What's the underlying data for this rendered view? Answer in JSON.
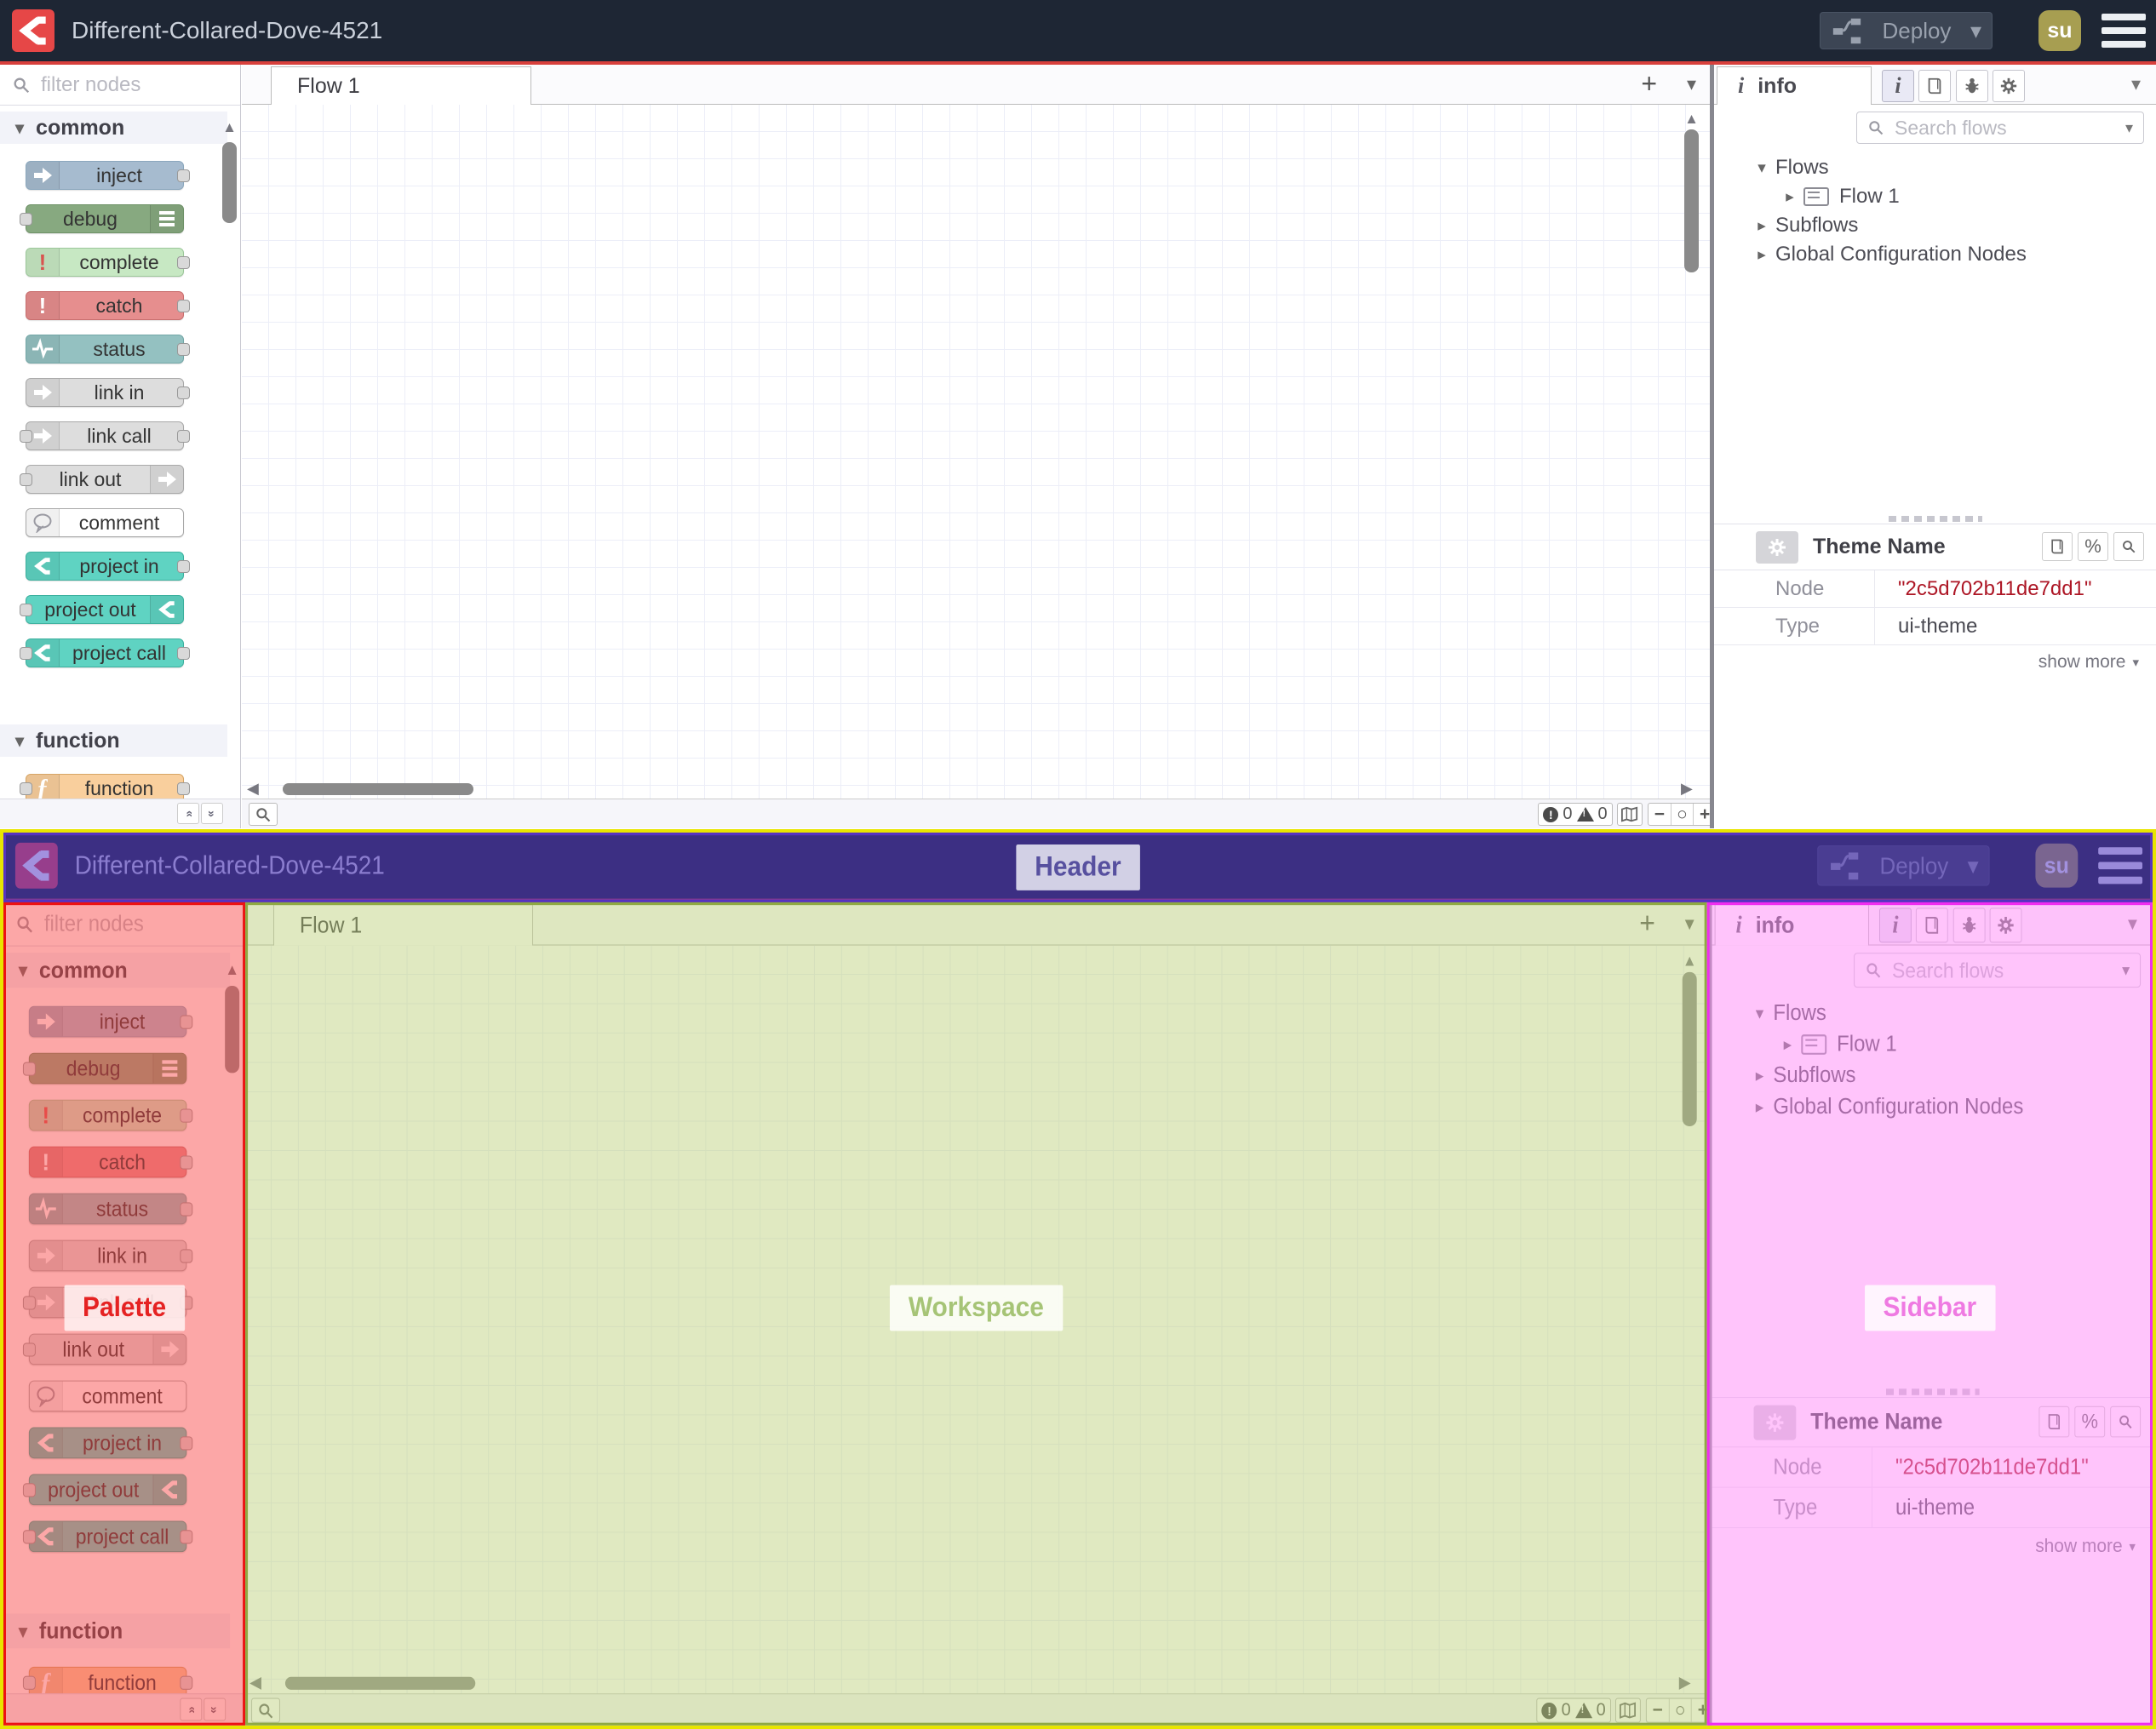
{
  "header": {
    "title": "Different-Collared-Dove-4521",
    "deploy_label": "Deploy",
    "user_initials": "su"
  },
  "palette": {
    "filter_placeholder": "filter nodes",
    "categories": [
      {
        "label": "common",
        "nodes": [
          {
            "label": "inject",
            "color": "#a6bbcf",
            "border": "#8ba7bd",
            "icon": "arrow",
            "icon_side": "l",
            "ports": "r"
          },
          {
            "label": "debug",
            "color": "#87a980",
            "border": "#6f9268",
            "icon": "bars",
            "icon_side": "r",
            "ports": "l"
          },
          {
            "label": "complete",
            "color": "#c7e8c3",
            "border": "#9cc79a",
            "icon": "excl-red",
            "icon_side": "l",
            "ports": "r"
          },
          {
            "label": "catch",
            "color": "#e68e8e",
            "border": "#c96f6f",
            "icon": "excl",
            "icon_side": "l",
            "ports": "r"
          },
          {
            "label": "status",
            "color": "#94c1c1",
            "border": "#73a7a7",
            "icon": "pulse",
            "icon_side": "l",
            "ports": "r"
          },
          {
            "label": "link in",
            "color": "#dddddd",
            "border": "#a9a9a9",
            "icon": "arrow",
            "icon_side": "l",
            "ports": "r"
          },
          {
            "label": "link call",
            "color": "#dddddd",
            "border": "#a9a9a9",
            "icon": "arrow",
            "icon_side": "l",
            "ports": "lr"
          },
          {
            "label": "link out",
            "color": "#dddddd",
            "border": "#a9a9a9",
            "icon": "arrow",
            "icon_side": "r",
            "ports": "l"
          },
          {
            "label": "comment",
            "color": "#ffffff",
            "border": "#a9a9a9",
            "icon": "bubble",
            "icon_side": "l",
            "ports": ""
          },
          {
            "label": "project in",
            "color": "#5fd3c2",
            "border": "#3cb09e",
            "icon": "nrmark",
            "icon_side": "l",
            "ports": "r"
          },
          {
            "label": "project out",
            "color": "#5fd3c2",
            "border": "#3cb09e",
            "icon": "nrmark",
            "icon_side": "r",
            "ports": "l"
          },
          {
            "label": "project call",
            "color": "#5fd3c2",
            "border": "#3cb09e",
            "icon": "nrmark",
            "icon_side": "l",
            "ports": "lr"
          }
        ]
      },
      {
        "label": "function",
        "nodes": [
          {
            "label": "function",
            "color": "#f9cf9d",
            "border": "#d6a566",
            "icon": "fn",
            "icon_side": "l",
            "ports": "lr"
          }
        ]
      }
    ]
  },
  "workspace": {
    "tab_label": "Flow 1",
    "add_tab_label": "+",
    "status": {
      "error_count": "0",
      "warning_count": "0"
    }
  },
  "sidebar": {
    "tab_label": "info",
    "search_placeholder": "Search flows",
    "tree": [
      {
        "label": "Flows",
        "chevron": "down",
        "depth": 0,
        "flow_icon": false
      },
      {
        "label": "Flow 1",
        "chevron": "right",
        "depth": 1,
        "flow_icon": true
      },
      {
        "label": "Subflows",
        "chevron": "right",
        "depth": 0,
        "flow_icon": false
      },
      {
        "label": "Global Configuration Nodes",
        "chevron": "right",
        "depth": 0,
        "flow_icon": false
      }
    ],
    "panel": {
      "title": "Theme Name",
      "rows": [
        {
          "key": "Node",
          "value": "\"2c5d702b11de7dd1\""
        },
        {
          "key": "Type",
          "value": "ui-theme"
        }
      ],
      "show_more_label": "show more"
    }
  },
  "annotations": {
    "header": "Header",
    "palette": "Palette",
    "workspace": "Workspace",
    "sidebar": "Sidebar"
  },
  "colors": {
    "header_bg": "#1e2634",
    "header_accent_line": "#d8403c",
    "logo_red": "#e64747",
    "avatar_olive": "#a79e51",
    "node_id_red": "#ad1625",
    "annotation_yellow": "#e8e500",
    "annotation_red": "#ec1212",
    "annotation_green": "#8fa943",
    "annotation_magenta": "#f02cf0",
    "annotation_purple": "#5633c0"
  }
}
